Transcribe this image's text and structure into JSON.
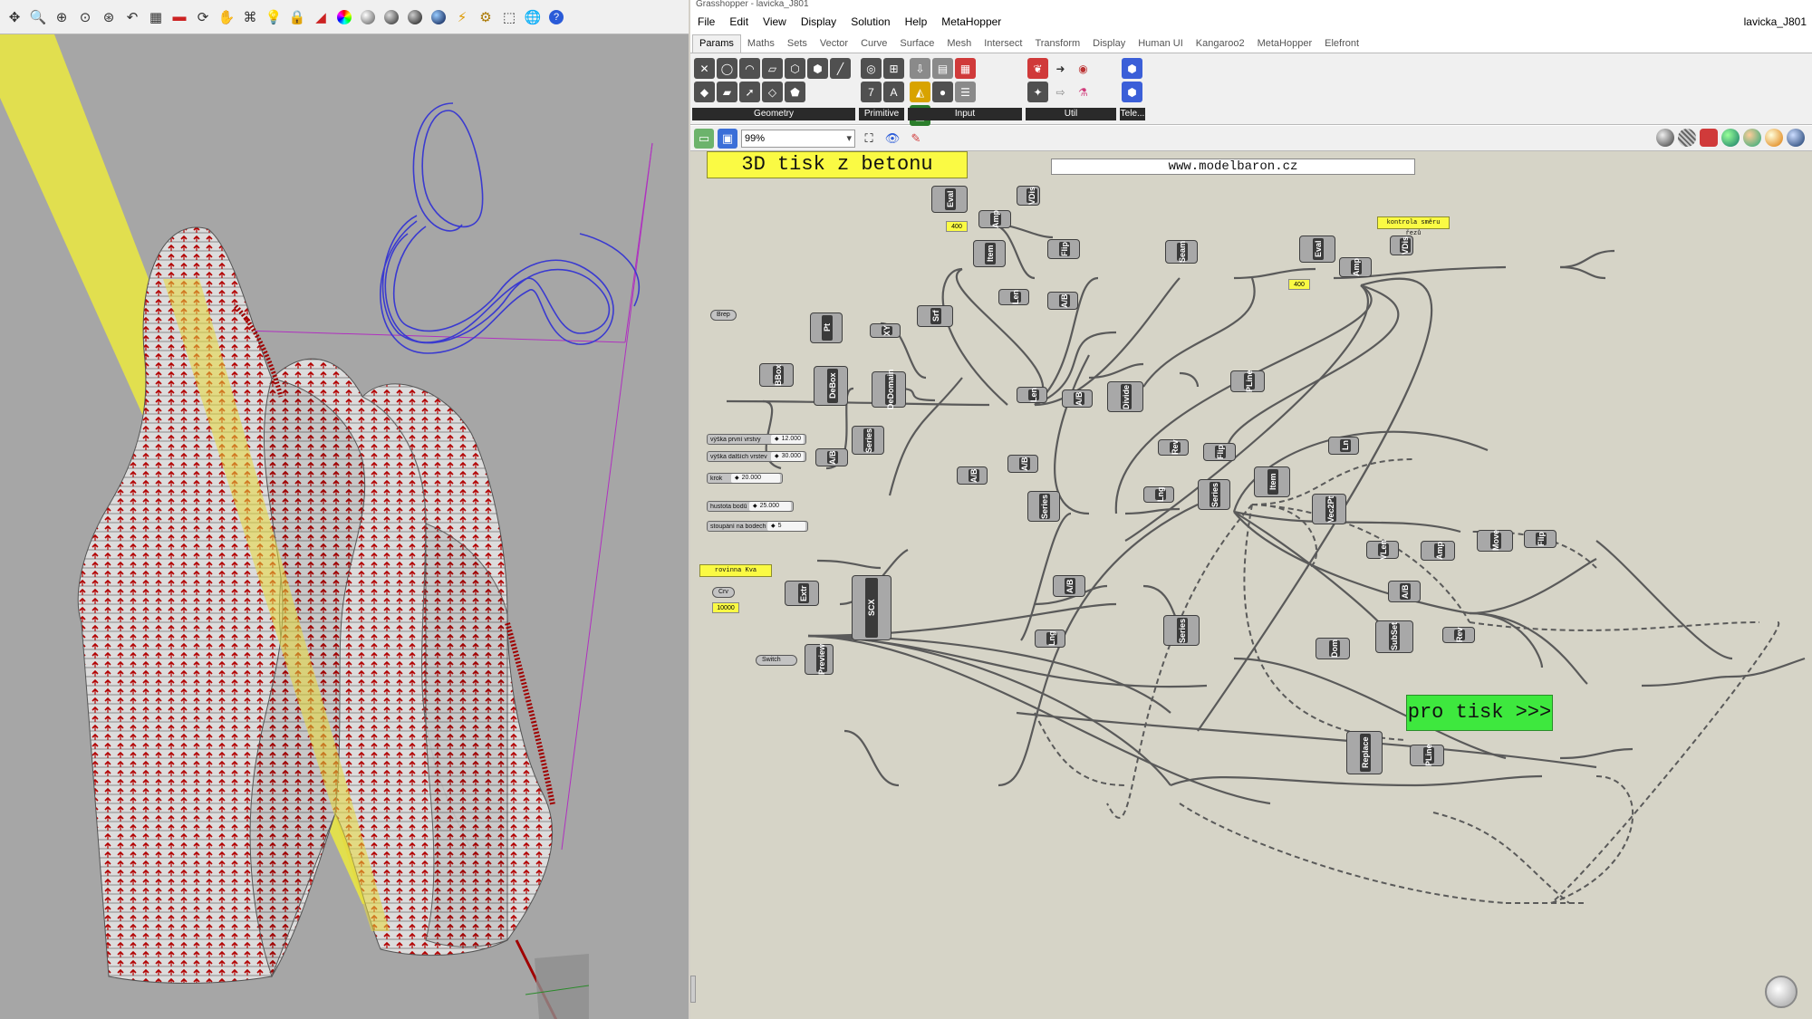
{
  "rhino": {
    "toolbar_icons": [
      "move-icon",
      "zoom-icon",
      "zoom-window-icon",
      "zoom-extents-icon",
      "zoom-selected-icon",
      "undo-view-icon",
      "grid-icon",
      "ruler-icon",
      "rotate-icon",
      "pan-icon",
      "named-view-icon",
      "light-icon",
      "lock-icon",
      "curve-icon",
      "color-wheel-icon",
      "shaded-sphere-icon",
      "render-sphere-icon",
      "material-sphere-icon",
      "filter-icon",
      "gear-icon",
      "select-icon",
      "globe-icon",
      "help-icon"
    ]
  },
  "grasshopper": {
    "title": "Grasshopper - lavicka_J801",
    "menu": [
      "File",
      "Edit",
      "View",
      "Display",
      "Solution",
      "Help",
      "MetaHopper"
    ],
    "document_name": "lavicka_J801",
    "tabs": [
      "Params",
      "Maths",
      "Sets",
      "Vector",
      "Curve",
      "Surface",
      "Mesh",
      "Intersect",
      "Transform",
      "Display",
      "Human UI",
      "Kangaroo2",
      "MetaHopper",
      "Elefront"
    ],
    "active_tab": "Params",
    "ribbon_groups": [
      "Geometry",
      "Primitive",
      "Input",
      "Util",
      "Tele..."
    ],
    "zoom": "99%",
    "colors": {
      "panel_yellow": "#fafa44",
      "panel_green": "#3ee83e",
      "canvas": "#d6d4c7",
      "component_dark": "#3a3a3a",
      "wire": "#5a5a5a"
    }
  },
  "canvas": {
    "title_panel": "3D tisk z betonu",
    "url_panel": "www.modelbaron.cz",
    "check_panel": "kontrola směru řezů",
    "curve_panel": "rovinna Kva",
    "print_panel": "pro tisk >>>",
    "number_panels": [
      "400",
      "400",
      "10000"
    ],
    "params": [
      "Brep",
      "Crv",
      "Switch"
    ],
    "sliders": [
      {
        "name": "výška první vrstvy",
        "value": "12.000"
      },
      {
        "name": "výška dalších vrstev",
        "value": "30.000"
      },
      {
        "name": "krok",
        "value": "20.000"
      },
      {
        "name": "hustota bodů",
        "value": "25.000"
      },
      {
        "name": "stoupání na bodech",
        "value": "5"
      }
    ],
    "components": [
      "Eval",
      "VDis",
      "Amp",
      "Item",
      "Flip",
      "Seam",
      "Eval",
      "VDis",
      "Amp",
      "Len",
      "A/B",
      "Srf",
      "Pt",
      "XY",
      "BBox",
      "DeBox",
      "DeDomain",
      "Series",
      "A/B",
      "Len",
      "A/B",
      "Divide",
      "PLine",
      "Rev",
      "Flip",
      "Ln",
      "A/B",
      "A/B",
      "Series",
      "Lng",
      "Series",
      "Item",
      "Vec2Pt",
      "VLen",
      "Amp",
      "Move",
      "Flip",
      "Extr",
      "SCX",
      "Preview",
      "A/B",
      "A/B",
      "Lng",
      "Series",
      "Dom",
      "SubSet",
      "Rev",
      "Replace",
      "PLine"
    ]
  }
}
